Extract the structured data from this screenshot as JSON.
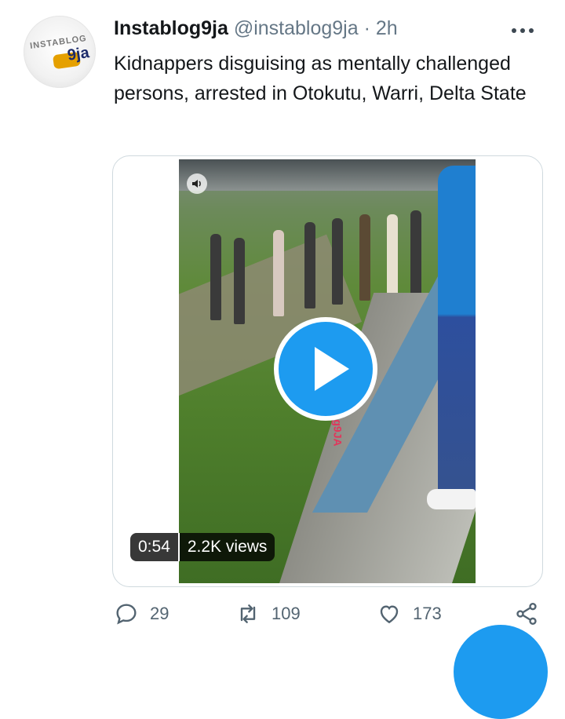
{
  "tweet": {
    "name": "Instablog9ja",
    "handle": "@instablog9ja",
    "separator": "·",
    "time": "2h",
    "avatar": {
      "logo_top": "INSTABLOG",
      "logo_tail": "9ja"
    },
    "text": "Kidnappers disguising as mentally challenged persons, arrested in Otokutu, Warri, Delta State"
  },
  "video": {
    "duration": "0:54",
    "views": "2.2K views",
    "watermark": "blog9JA"
  },
  "actions": {
    "reply_count": "29",
    "retweet_count": "109",
    "like_count": "173"
  },
  "icons": {
    "more": "more-horizontal-icon",
    "reply": "reply-icon",
    "retweet": "retweet-icon",
    "like": "heart-icon",
    "share": "share-icon",
    "play": "play-icon",
    "sound": "speaker-icon"
  },
  "colors": {
    "accent": "#1d9bf0",
    "text": "#14171a",
    "muted": "#657786"
  }
}
